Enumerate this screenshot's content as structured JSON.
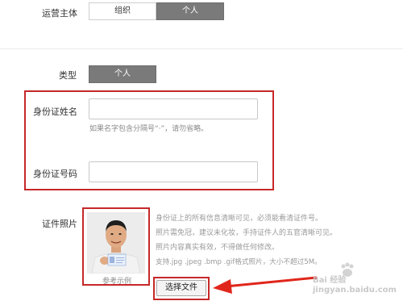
{
  "form": {
    "operator_label": "运营主体",
    "operator_options": [
      "组织",
      "个人"
    ],
    "type_label": "类型",
    "type_value": "个人",
    "id_name_label": "身份证姓名",
    "id_name_hint": "如果名字包含分隔号“·”，请勿省略。",
    "id_number_label": "身份证号码",
    "photo_label": "证件照片",
    "photo_caption": "参考示例",
    "upload_button": "选择文件",
    "photo_tips": [
      "身份证上的所有信息清晰可见，必须能看清证件号。",
      "照片需免冠，建议未化妆，手持证件人的五官清晰可见。",
      "照片内容真实有效，不得做任何修改。",
      "支持.jpg .jpeg .bmp .gif格式照片，大小不超过5M。"
    ]
  },
  "watermark": "Bai 经验 jingyan.baidu.com",
  "colors": {
    "highlight": "#c62828",
    "selected_segment": "#7a7a7a",
    "arrow": "#e0261b"
  }
}
